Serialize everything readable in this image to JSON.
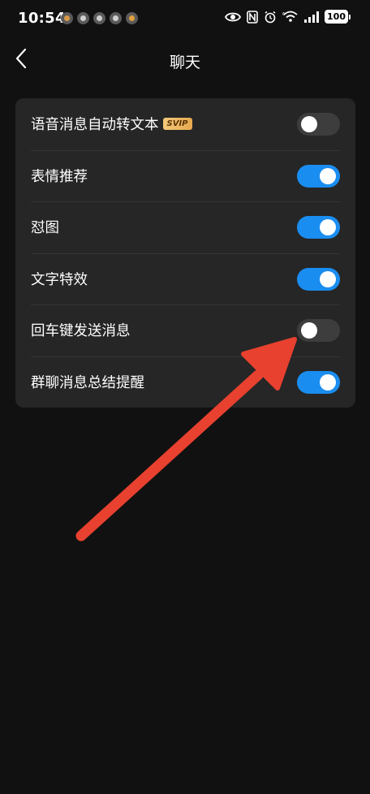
{
  "status_bar": {
    "time": "10:54",
    "battery": "100",
    "notification_icons": [
      "app-notification-icon",
      "app-notification-icon",
      "app-notification-icon",
      "app-notification-icon",
      "app-notification-icon"
    ],
    "system_icons": [
      "eye-icon",
      "nfc-icon",
      "alarm-icon",
      "wifi-icon",
      "signal-icon",
      "battery-icon"
    ]
  },
  "header": {
    "title": "聊天",
    "back_icon": "chevron-left-icon"
  },
  "settings": {
    "items": [
      {
        "label": "语音消息自动转文本",
        "badge": "SVIP",
        "enabled": false
      },
      {
        "label": "表情推荐",
        "enabled": true
      },
      {
        "label": "怼图",
        "enabled": true
      },
      {
        "label": "文字特效",
        "enabled": true
      },
      {
        "label": "回车键发送消息",
        "enabled": false
      },
      {
        "label": "群聊消息总结提醒",
        "enabled": true
      }
    ]
  },
  "colors": {
    "background": "#111111",
    "card": "#262626",
    "toggle_on": "#1a8df0",
    "toggle_off": "#3d3d3d",
    "annotation_arrow": "#e8412f",
    "svip_badge": "#e7a94e"
  },
  "annotation": {
    "icon": "arrow-icon",
    "points_to": "回车键发送消息"
  }
}
